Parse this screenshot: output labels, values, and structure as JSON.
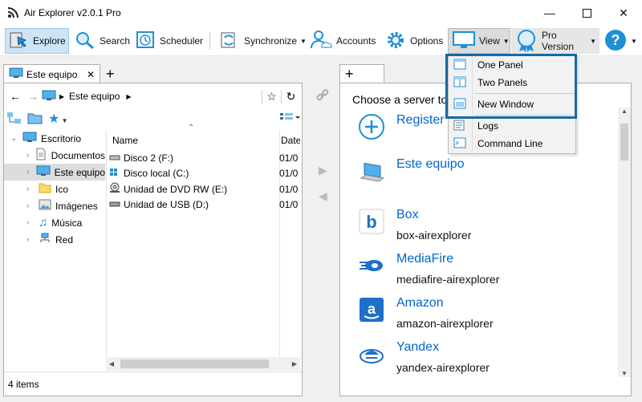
{
  "window": {
    "title": "Air Explorer v2.0.1 Pro",
    "controls": [
      "minimize-icon",
      "maximize-icon",
      "close-icon"
    ]
  },
  "toolbar": {
    "explore": "Explore",
    "search": "Search",
    "scheduler": "Scheduler",
    "synchronize": "Synchronize",
    "accounts": "Accounts",
    "options": "Options",
    "view": "View",
    "pro_version": "Pro Version"
  },
  "view_menu": {
    "items": [
      "One Panel",
      "Two Panels",
      "New Window",
      "Logs",
      "Command Line"
    ]
  },
  "left_panel": {
    "tab_label": "Este equipo",
    "add_tab": "+",
    "breadcrumb": "Este equipo",
    "tree": [
      {
        "label": "Escritorio"
      },
      {
        "label": "Documentos"
      },
      {
        "label": "Este equipo"
      },
      {
        "label": "Ico"
      },
      {
        "label": "Imágenes"
      },
      {
        "label": "Música"
      },
      {
        "label": "Red"
      }
    ],
    "columns": [
      "Name",
      "Date"
    ],
    "files": [
      {
        "name": "Disco 2 (F:)",
        "date": "01/0"
      },
      {
        "name": "Disco local (C:)",
        "date": "01/0"
      },
      {
        "name": "Unidad de DVD RW (E:)",
        "date": "01/0"
      },
      {
        "name": "Unidad de USB (D:)",
        "date": "01/0"
      }
    ],
    "status": "4 items"
  },
  "right_panel": {
    "add_tab": "+",
    "prompt": "Choose a server to",
    "servers": [
      {
        "name": "Register",
        "account": ""
      },
      {
        "name": "Este equipo",
        "account": ""
      },
      {
        "name": "Box",
        "account": "box-airexplorer"
      },
      {
        "name": "MediaFire",
        "account": "mediafire-airexplorer"
      },
      {
        "name": "Amazon",
        "account": "amazon-airexplorer"
      },
      {
        "name": "Yandex",
        "account": "yandex-airexplorer"
      }
    ]
  },
  "colors": {
    "accent": "#0066cc",
    "active_button": "#cde4f7",
    "menu_highlight_border": "#1569a8"
  }
}
